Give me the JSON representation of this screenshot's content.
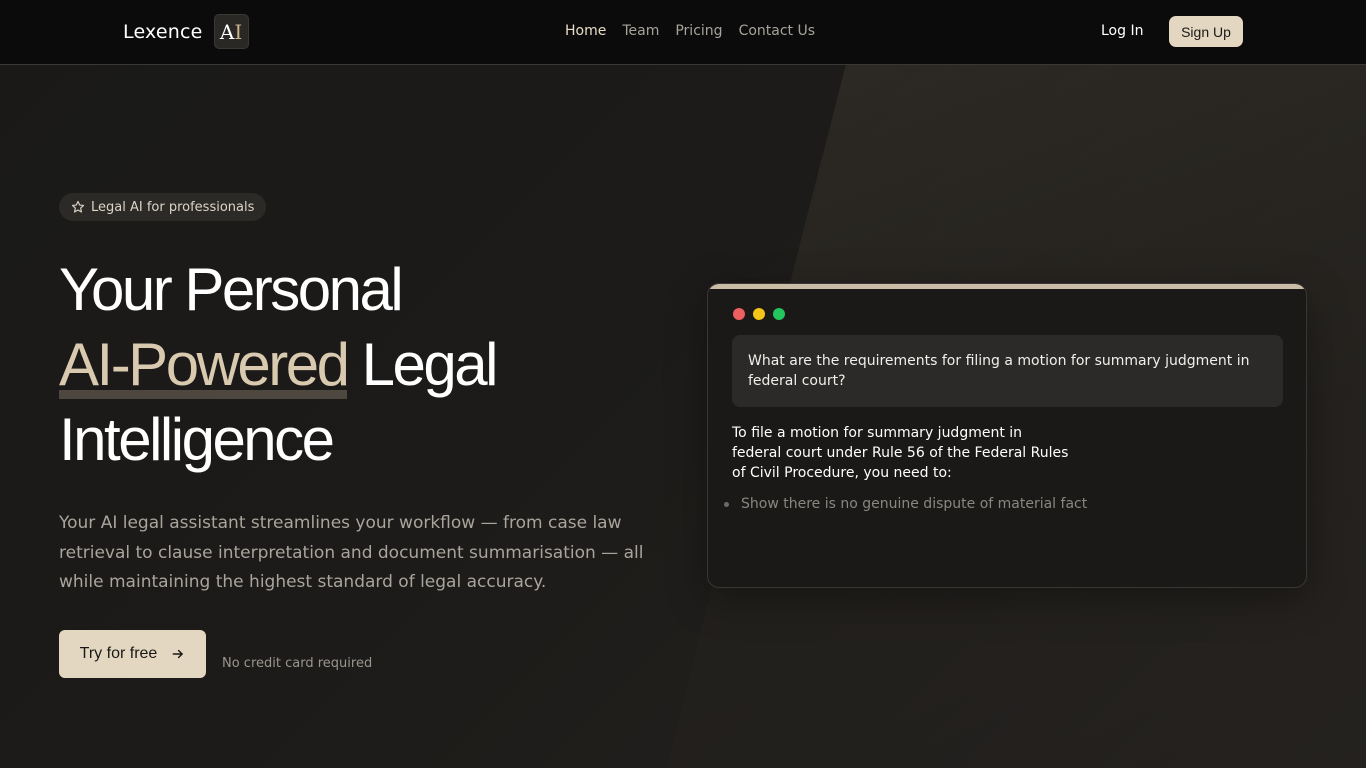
{
  "nav": {
    "brand": "Lexence",
    "logo_a": "A",
    "logo_i": "I",
    "links": [
      "Home",
      "Team",
      "Pricing",
      "Contact Us"
    ],
    "login": "Log In",
    "signup": "Sign Up"
  },
  "hero": {
    "badge": "Legal AI for professionals",
    "headline_line1": "Your Personal",
    "headline_accent": "AI-Powered",
    "headline_line2_rest": " Legal",
    "headline_line3": "Intelligence",
    "subtitle": "Your AI legal assistant streamlines your workflow — from case law retrieval to clause interpretation and document summarisation — all while maintaining the highest standard of legal accuracy.",
    "cta": "Try for free",
    "cta_note": "No credit card required"
  },
  "chat": {
    "window_dots": [
      "#ef5f5f",
      "#f5c518",
      "#22c55e"
    ],
    "question": "What are the requirements for filing a motion for summary judgment in federal court?",
    "answer": "To file a motion for summary judgment in federal court under Rule 56 of the Federal Rules of Civil Procedure, you need to:",
    "bullets": [
      "Show there is no genuine dispute of material fact"
    ]
  },
  "colors": {
    "accent": "#e4d7c1",
    "headline_accent": "#d8c9af",
    "background": "#161514"
  }
}
